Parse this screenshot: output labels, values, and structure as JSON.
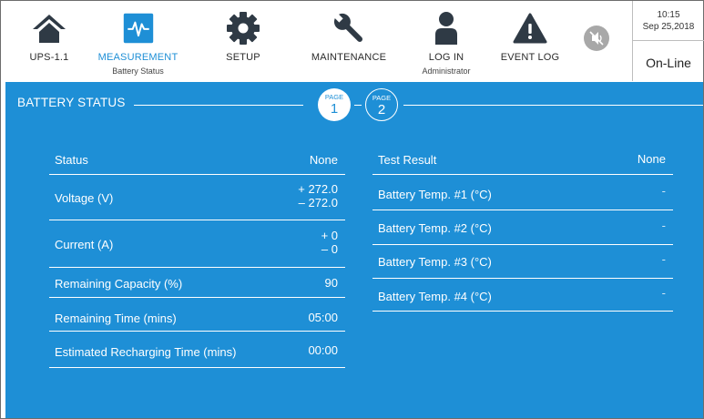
{
  "nav": {
    "items": [
      {
        "label": "UPS-1.1",
        "sub": ""
      },
      {
        "label": "MEASUREMENT",
        "sub": "Battery Status"
      },
      {
        "label": "SETUP",
        "sub": ""
      },
      {
        "label": "MAINTENANCE",
        "sub": ""
      },
      {
        "label": "LOG IN",
        "sub": "Administrator"
      },
      {
        "label": "EVENT LOG",
        "sub": ""
      }
    ],
    "active_item": "MEASUREMENT"
  },
  "status": {
    "time": "10:15",
    "date": "Sep 25,2018",
    "mode": "On-Line"
  },
  "section": {
    "title": "BATTERY STATUS"
  },
  "pages": [
    {
      "caption": "PAGE",
      "number": "1",
      "selected": true
    },
    {
      "caption": "PAGE",
      "number": "2",
      "selected": false
    }
  ],
  "left_table": [
    {
      "label": "Status",
      "value": "None"
    },
    {
      "label": "Voltage (V)",
      "value_pos": "+ 272.0",
      "value_neg": "– 272.0"
    },
    {
      "label": "Current (A)",
      "value_pos": "+ 0",
      "value_neg": "– 0"
    },
    {
      "label": "Remaining Capacity (%)",
      "value": "90"
    },
    {
      "label": "Remaining Time (mins)",
      "value": "05:00"
    },
    {
      "label": "Estimated Recharging Time (mins)",
      "value": "00:00"
    }
  ],
  "right_table": [
    {
      "label": "Test Result",
      "value": "None"
    },
    {
      "label": "Battery Temp. #1 (°C)",
      "value": "-"
    },
    {
      "label": "Battery Temp. #2 (°C)",
      "value": "-"
    },
    {
      "label": "Battery Temp. #3 (°C)",
      "value": "-"
    },
    {
      "label": "Battery Temp. #4 (°C)",
      "value": "-"
    }
  ],
  "colors": {
    "panel": "#1e8fd6",
    "nav_icon": "#2f3a45",
    "accent": "#1e8fd6"
  }
}
